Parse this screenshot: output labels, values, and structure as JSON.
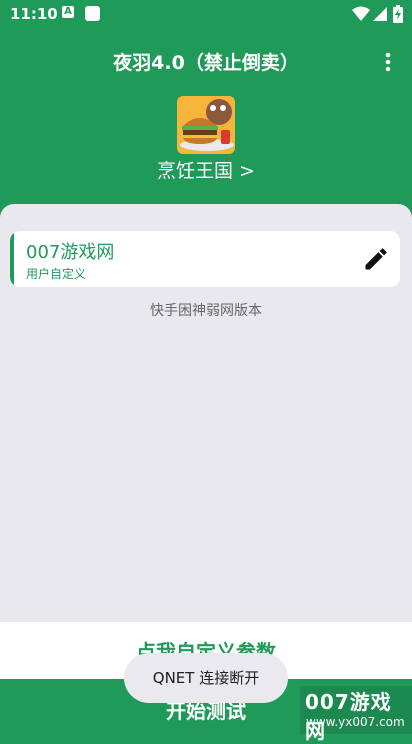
{
  "status_bar": {
    "time": "11:10",
    "a_icon_letter": "A",
    "icons": [
      "a-icon",
      "square-app-icon",
      "wifi-icon",
      "signal-icon",
      "battery-icon"
    ]
  },
  "app_bar": {
    "title": "夜羽4.0（禁止倒卖）",
    "menu_icon": "more-vert-icon"
  },
  "game": {
    "name": "烹饪王国 >",
    "icon": "burger-game-icon"
  },
  "config_card": {
    "name": "007游戏网",
    "subtitle": "用户自定义",
    "edit_icon": "pencil-icon"
  },
  "hint": "快手困神弱网版本",
  "buttons": {
    "custom_params": "点我自定义参数",
    "start_test": "开始测试"
  },
  "toast": "QNET 连接断开",
  "watermark": {
    "title": "007游戏网",
    "url": "www.yx007.com"
  },
  "colors": {
    "primary": "#1f9a59",
    "panel_bg": "#e9e8ef",
    "card_bg": "#ffffff",
    "toast_bg": "#e9e9ee"
  }
}
